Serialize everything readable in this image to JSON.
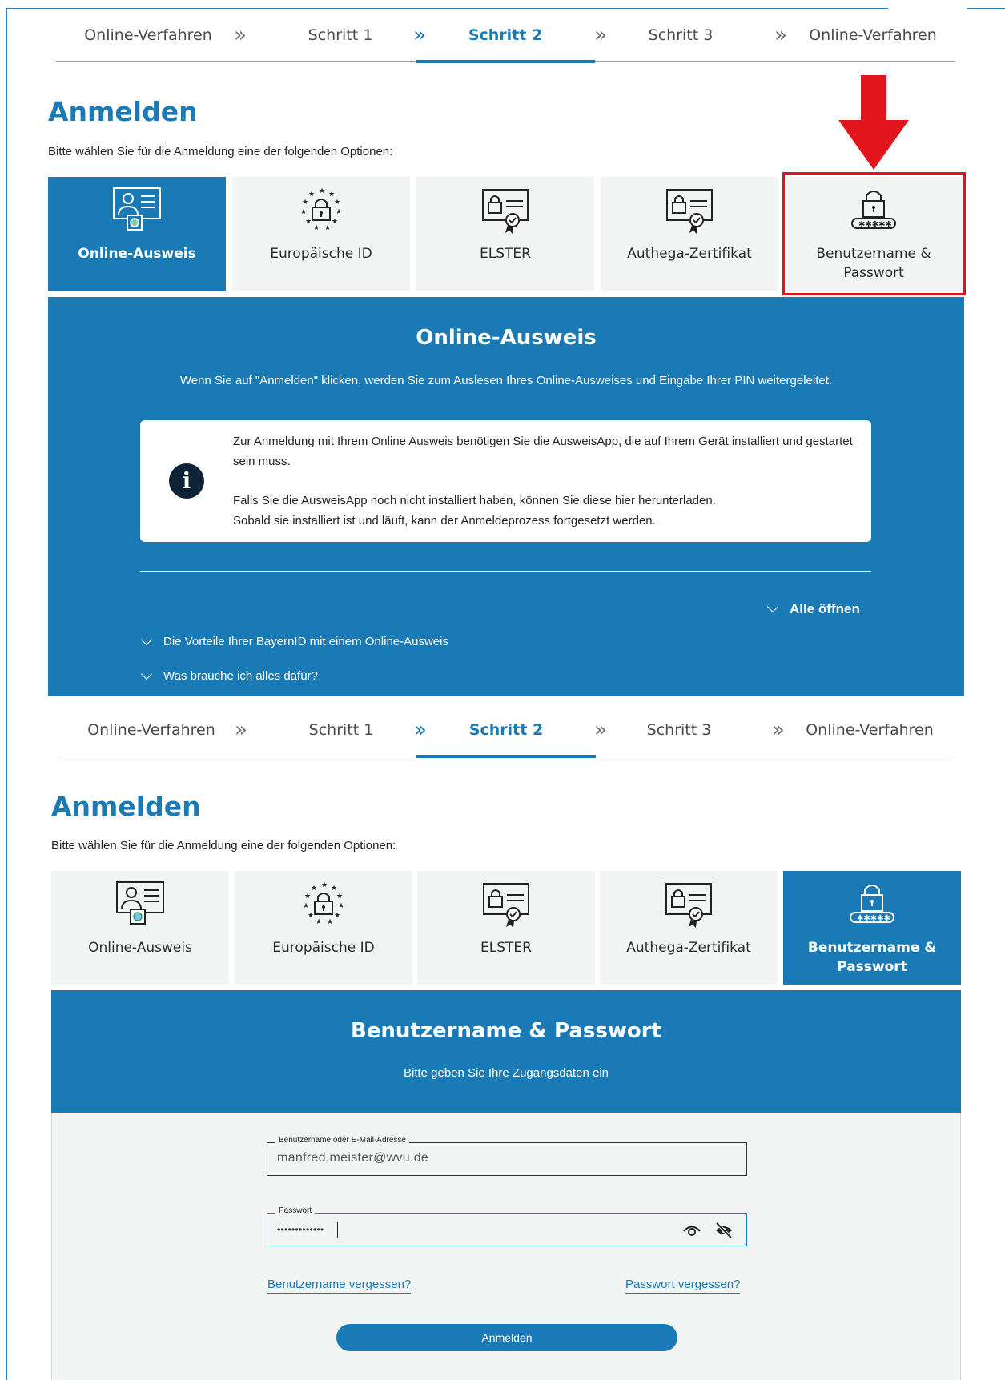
{
  "steps": [
    {
      "label": "Online-Verfahren"
    },
    {
      "label": "Schritt 1"
    },
    {
      "label": "Schritt 2"
    },
    {
      "label": "Schritt 3"
    },
    {
      "label": "Online-Verfahren"
    }
  ],
  "step_separator": "»",
  "active_step_index": 2,
  "page_title": "Anmelden",
  "intro_text": "Bitte wählen Sie für die Anmeldung eine der folgenden Optionen:",
  "options": [
    {
      "label": "Online-Ausweis",
      "icon": "id-card-icon"
    },
    {
      "label": "Europäische ID",
      "icon": "eu-lock-icon"
    },
    {
      "label": "ELSTER",
      "icon": "certificate-lock-icon"
    },
    {
      "label": "Authega-Zertifikat",
      "icon": "certificate-lock-icon"
    },
    {
      "label": "Benutzername & Passwort",
      "icon": "password-lock-icon"
    }
  ],
  "screen1": {
    "selected_option": "Online-Ausweis",
    "panel_title": "Online-Ausweis",
    "panel_text": "Wenn Sie auf \"Anmelden\" klicken, werden Sie zum Auslesen Ihres Online-Ausweises und Eingabe Ihrer PIN weitergeleitet.",
    "info_icon": "i",
    "info_p1": "Zur Anmeldung mit Ihrem Online Ausweis benötigen Sie die AusweisApp, die auf Ihrem Gerät installiert und gestartet sein muss.",
    "info_p2_line1": "Falls Sie die AusweisApp noch nicht installiert haben, können Sie diese hier herunterladen.",
    "info_p2_line2": "Sobald sie installiert ist und läuft, kann der Anmeldeprozess fortgesetzt werden.",
    "open_all": "Alle öffnen",
    "accordion": [
      "Die Vorteile Ihrer BayernID mit einem Online-Ausweis",
      "Was brauche ich alles dafür?"
    ]
  },
  "screen2": {
    "selected_option": "Benutzername & Passwort",
    "panel_title": "Benutzername & Passwort",
    "panel_text": "Bitte geben Sie Ihre Zugangsdaten ein",
    "username_label": "Benutzername oder E-Mail-Adresse",
    "username_value": "manfred.meister@wvu.de",
    "password_label": "Passwort",
    "password_value": "•••••••••••••",
    "forgot_username": "Benutzername vergessen?",
    "forgot_password": "Passwort vergessen?",
    "submit_label": "Anmelden"
  },
  "annotation": {
    "color": "#e2141c"
  },
  "colors": {
    "primary": "#1a7ab5",
    "tile_bg": "#f3f4f4"
  }
}
